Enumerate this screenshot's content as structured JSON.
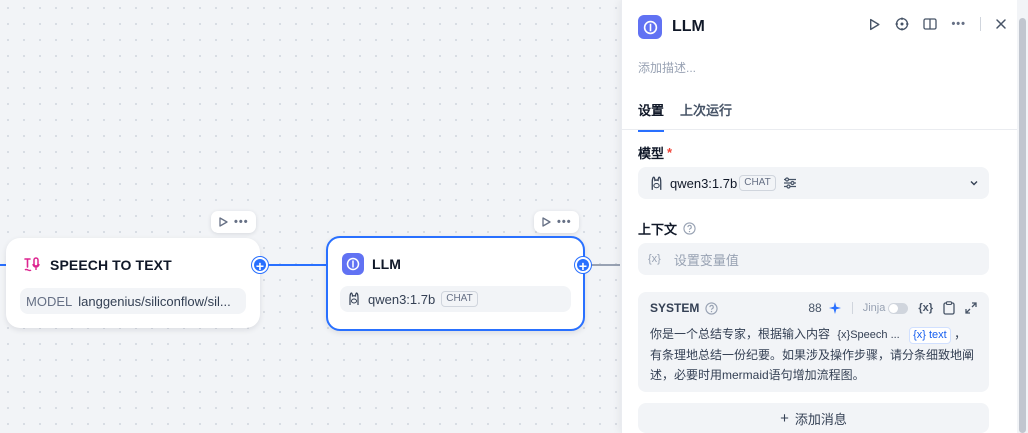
{
  "canvas": {
    "speech_node": {
      "title": "SPEECH TO TEXT",
      "model_label": "MODEL",
      "model_value": "langgenius/siliconflow/sil..."
    },
    "llm_node": {
      "title": "LLM",
      "model": "qwen3:1.7b",
      "mode_badge": "CHAT"
    },
    "toolbar_more": "•••"
  },
  "panel": {
    "title": "LLM",
    "description_placeholder": "添加描述...",
    "tabs": [
      {
        "label": "设置",
        "active": true
      },
      {
        "label": "上次运行",
        "active": false
      }
    ],
    "model_section": {
      "label": "模型",
      "required_mark": "*",
      "model_name": "qwen3:1.7b",
      "mode_badge": "CHAT"
    },
    "context_section": {
      "label": "上下文",
      "var_symbol": "{x}",
      "placeholder": "设置变量值"
    },
    "system_prompt": {
      "label": "SYSTEM",
      "token_count": "88",
      "jinja_label": "Jinja",
      "var_symbol": "{x}",
      "text_before": "你是一个总结专家，根据输入内容",
      "var_chip_grey": "{x}Speech ...",
      "var_chip_blue": "{x} text",
      "text_after": "，有条理地总结一份纪要。如果涉及操作步骤，请分条细致地阐述，必要时用mermaid语句增加流程图。"
    },
    "add_message": {
      "plus": "+",
      "label": "添加消息"
    }
  },
  "colors": {
    "accent": "#2970ff",
    "llm_icon": "#6172f3",
    "speech_icon": "#dd2590",
    "canvas_bg": "#f2f4f7"
  }
}
